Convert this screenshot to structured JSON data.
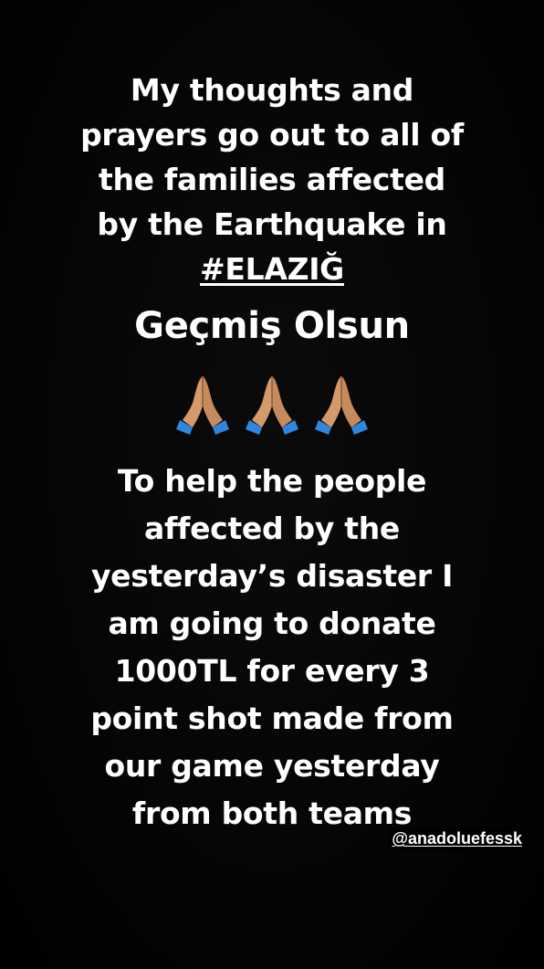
{
  "story": {
    "background_color": "#000000",
    "text_color": "#ffffff",
    "intro_lines": [
      "My thoughts and",
      "prayers go out to all of",
      "the families affected",
      "by the Earthquake in"
    ],
    "hashtag": "#ELAZIĞ",
    "greeting": "Geçmiş Olsun",
    "emojis": [
      "folded-hands-icon",
      "folded-hands-icon",
      "folded-hands-icon"
    ],
    "body_lines": [
      "To help the people",
      "affected by the",
      "yesterday’s disaster I",
      "am going to donate",
      "1000TL for every 3",
      "point shot made from",
      "our game yesterday",
      "from both teams"
    ],
    "mention": "@anadoluefessk"
  }
}
